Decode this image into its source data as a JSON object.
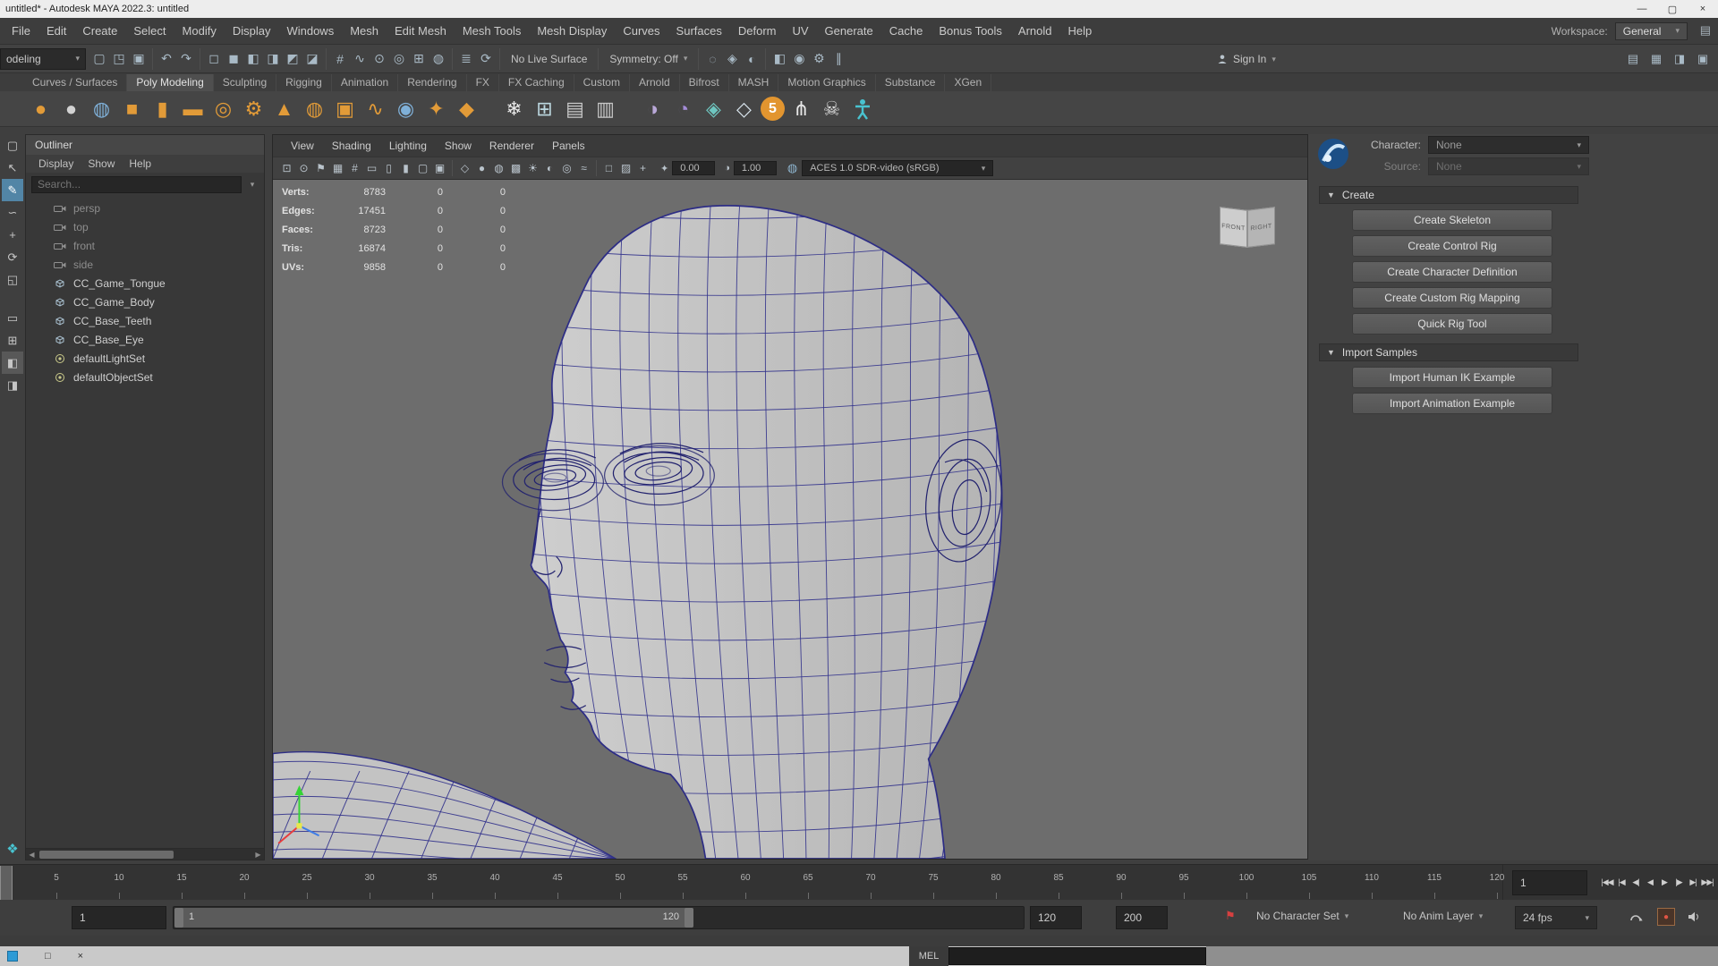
{
  "window": {
    "title": "untitled* - Autodesk MAYA 2022.3: untitled",
    "minimize_glyph": "—",
    "maximize_glyph": "▢",
    "close_glyph": "×"
  },
  "menubar": {
    "items": [
      "File",
      "Edit",
      "Create",
      "Select",
      "Modify",
      "Display",
      "Windows",
      "Mesh",
      "Edit Mesh",
      "Mesh Tools",
      "Mesh Display",
      "Curves",
      "Surfaces",
      "Deform",
      "UV",
      "Generate",
      "Cache",
      "Bonus Tools",
      "Arnold",
      "Help"
    ],
    "workspace_label": "Workspace:",
    "workspace_value": "General"
  },
  "statusline": {
    "mode": "odeling",
    "segments": [
      {
        "icons": [
          {
            "n": "new-scene-icon",
            "g": "▢"
          },
          {
            "n": "open-scene-icon",
            "g": "◳"
          },
          {
            "n": "save-scene-icon",
            "g": "▣"
          }
        ]
      },
      {
        "icons": [
          {
            "n": "undo-icon",
            "g": "↶"
          },
          {
            "n": "redo-icon",
            "g": "↷"
          }
        ]
      },
      {
        "icons": [
          {
            "n": "select-by-hierarchy-icon",
            "g": "◻"
          },
          {
            "n": "select-by-object-icon",
            "g": "◼"
          },
          {
            "n": "select-by-component-icon",
            "g": "◧"
          },
          {
            "n": "select-mask-points-icon",
            "g": "◨"
          },
          {
            "n": "select-mask-lines-icon",
            "g": "◩"
          },
          {
            "n": "select-mask-faces-icon",
            "g": "◪"
          }
        ]
      },
      {
        "icons": [
          {
            "n": "snap-to-grid-icon",
            "g": "#"
          },
          {
            "n": "snap-to-curve-icon",
            "g": "∿"
          },
          {
            "n": "snap-to-point-icon",
            "g": "⊙"
          },
          {
            "n": "snap-to-projected-center-icon",
            "g": "◎"
          },
          {
            "n": "snap-to-view-plane-icon",
            "g": "⊞"
          },
          {
            "n": "make-live-icon",
            "g": "◍"
          }
        ]
      },
      {
        "icons": [
          {
            "n": "construction-history-icon",
            "g": "≣"
          },
          {
            "n": "recent-commands-icon",
            "g": "⟳"
          }
        ]
      },
      {
        "text": "No Live Surface",
        "n": "no-live-surface-label"
      },
      {
        "text": "Symmetry: Off",
        "n": "symmetry-dropdown",
        "arrow": true
      },
      {
        "icons": [
          {
            "n": "highlight-selection-icon",
            "g": "◌"
          },
          {
            "n": "wireframe-on-shaded-toggle-icon",
            "g": "◈"
          },
          {
            "n": "default-material-icon",
            "g": "◐"
          }
        ]
      },
      {
        "icons": [
          {
            "n": "render-current-frame-icon",
            "g": "◧"
          },
          {
            "n": "ipr-render-icon",
            "g": "◉"
          },
          {
            "n": "render-settings-icon",
            "g": "⚙"
          },
          {
            "n": "pause-icon",
            "g": "∥"
          }
        ]
      }
    ],
    "sign_in": "Sign In",
    "right_toggles": [
      {
        "n": "toggle-modeling-toolkit-icon",
        "g": "▤"
      },
      {
        "n": "toggle-humanik-icon",
        "g": "▦"
      },
      {
        "n": "toggle-attribute-editor-icon",
        "g": "◨"
      },
      {
        "n": "toggle-channel-box-icon",
        "g": "▣"
      }
    ]
  },
  "shelf": {
    "tabs": [
      "Curves / Surfaces",
      "Poly Modeling",
      "Sculpting",
      "Rigging",
      "Animation",
      "Rendering",
      "FX",
      "FX Caching",
      "Custom",
      "Arnold",
      "Bifrost",
      "MASH",
      "Motion Graphics",
      "Substance",
      "XGen"
    ],
    "active_tab": "Poly Modeling",
    "icons": [
      {
        "n": "poly-sphere-icon",
        "g": "●",
        "c": "#e29b38"
      },
      {
        "n": "nurbs-sphere-icon",
        "g": "●",
        "c": "#d2d2d2"
      },
      {
        "n": "subdiv-sphere-icon",
        "g": "◍",
        "c": "#7fb0d8"
      },
      {
        "n": "poly-cube-icon",
        "g": "■",
        "c": "#e29b38"
      },
      {
        "n": "poly-cylinder-icon",
        "g": "▮",
        "c": "#e29b38"
      },
      {
        "n": "poly-plane-icon",
        "g": "▬",
        "c": "#e29b38"
      },
      {
        "n": "poly-torus-icon",
        "g": "◎",
        "c": "#e29b38"
      },
      {
        "n": "poly-gear-icon",
        "g": "⚙",
        "c": "#e29b38"
      },
      {
        "n": "poly-cone-icon",
        "g": "▲",
        "c": "#e29b38"
      },
      {
        "n": "poly-disc-icon",
        "g": "◍",
        "c": "#e29b38"
      },
      {
        "n": "poly-pipe-icon",
        "g": "▣",
        "c": "#e29b38"
      },
      {
        "n": "poly-helix-icon",
        "g": "∿",
        "c": "#e29b38"
      },
      {
        "n": "poly-soccerball-icon",
        "g": "◉",
        "c": "#7fb0d8"
      },
      {
        "n": "platonic-solid-icon",
        "g": "✦",
        "c": "#e29b38"
      },
      {
        "n": "super-shape-icon",
        "g": "◆",
        "c": "#e29b38"
      },
      {
        "sep": true
      },
      {
        "n": "sculpt-mesh-icon",
        "g": "❄",
        "c": "#e8e8e8"
      },
      {
        "n": "mash-network-icon",
        "g": "⊞",
        "c": "#bcd8e0"
      },
      {
        "n": "image-plane-icon",
        "g": "▤",
        "c": "#c8c8c8"
      },
      {
        "n": "free-image-plane-icon",
        "g": "▥",
        "c": "#c8c8c8"
      },
      {
        "sep": true
      },
      {
        "n": "sphere-projection-icon",
        "g": "◑",
        "c": "#b9a8d8"
      },
      {
        "n": "uv-sphere-icon",
        "g": "◔",
        "c": "#a48cd8"
      },
      {
        "n": "sample-spheres-icon",
        "g": "◈",
        "c": "#6ec6c0"
      },
      {
        "n": "sample-spheres-light-icon",
        "g": "◇",
        "c": "#d8e4ec"
      },
      {
        "n": "five-badge-icon",
        "g": "5",
        "badge": true
      },
      {
        "n": "joint-tool-icon",
        "g": "⋔",
        "c": "#e6e6e6"
      },
      {
        "n": "skeleton-skull-icon",
        "g": "☠",
        "c": "#dcdcdc"
      },
      {
        "n": "humanik-character-icon",
        "svg": "person"
      }
    ]
  },
  "toolbox": {
    "tools": [
      {
        "n": "select-marquee-tool-icon",
        "g": "▢"
      },
      {
        "n": "select-tool-icon",
        "g": "↖"
      },
      {
        "n": "paint-select-t ool-icon",
        "g": "✎",
        "active": true
      },
      {
        "n": "lasso-tool-icon",
        "g": "∽"
      },
      {
        "n": "move-tool-icon",
        "g": "+"
      },
      {
        "n": "rotate-tool-icon",
        "g": "⟳"
      },
      {
        "n": "scale-tool-icon",
        "g": "◱"
      },
      {
        "n": "layout-single-pane-icon",
        "g": "▭",
        "gap": true
      },
      {
        "n": "layout-four-pane-icon",
        "g": "⊞"
      },
      {
        "n": "layout-outliner-pane-icon",
        "g": "◧",
        "current": true
      },
      {
        "n": "layout-custom-pane-icon",
        "g": "◨"
      }
    ],
    "bottom_icon": {
      "n": "xgen-editor-icon",
      "g": "❖"
    }
  },
  "outliner": {
    "title": "Outliner",
    "menus": [
      "Display",
      "Show",
      "Help"
    ],
    "search_placeholder": "Search...",
    "items": [
      {
        "label": "persp",
        "icon": "camera",
        "dim": true
      },
      {
        "label": "top",
        "icon": "camera",
        "dim": true
      },
      {
        "label": "front",
        "icon": "camera",
        "dim": true
      },
      {
        "label": "side",
        "icon": "camera",
        "dim": true
      },
      {
        "label": "CC_Game_Tongue",
        "icon": "mesh"
      },
      {
        "label": "CC_Game_Body",
        "icon": "mesh"
      },
      {
        "label": "CC_Base_Teeth",
        "icon": "mesh"
      },
      {
        "label": "CC_Base_Eye",
        "icon": "mesh"
      },
      {
        "label": "defaultLightSet",
        "icon": "set"
      },
      {
        "label": "defaultObjectSet",
        "icon": "set"
      }
    ]
  },
  "viewport": {
    "menus": [
      "View",
      "Shading",
      "Lighting",
      "Show",
      "Renderer",
      "Panels"
    ],
    "toolbar_icons": [
      {
        "n": "frame-all-icon",
        "g": "⊡"
      },
      {
        "n": "frame-selection-icon",
        "g": "⊙"
      },
      {
        "n": "bookmark-icon",
        "g": "⚑"
      },
      {
        "n": "camera-attributes-icon",
        "g": "▦"
      },
      {
        "n": "grid-toggle-icon",
        "g": "#"
      },
      {
        "n": "film-gate-icon",
        "g": "▭"
      },
      {
        "n": "resolution-gate-icon",
        "g": "▯"
      },
      {
        "n": "gate-mask-icon",
        "g": "▮"
      },
      {
        "n": "safe-action-icon",
        "g": "▢"
      },
      {
        "n": "safe-title-icon",
        "g": "▣"
      },
      {
        "sep": true
      },
      {
        "n": "wireframe-display-icon",
        "g": "◇"
      },
      {
        "n": "smooth-shade-icon",
        "g": "●"
      },
      {
        "n": "wireframe-on-shaded-icon",
        "g": "◍"
      },
      {
        "n": "textured-display-icon",
        "g": "▩"
      },
      {
        "n": "use-all-lights-icon",
        "g": "☀"
      },
      {
        "n": "shadows-icon",
        "g": "◐"
      },
      {
        "n": "ambient-occlusion-icon",
        "g": "◎"
      },
      {
        "n": "motion-blur-icon",
        "g": "≈"
      },
      {
        "sep": true
      },
      {
        "n": "isolate-select-icon",
        "g": "□"
      },
      {
        "n": "xray-icon",
        "g": "▨"
      },
      {
        "n": "joint-xray-icon",
        "g": "+"
      }
    ],
    "exposure_icon": "✦",
    "exposure": "0.00",
    "gamma_icon": "◑",
    "gamma": "1.00",
    "colorspace": "ACES 1.0 SDR-video (sRGB)",
    "hud": [
      {
        "label": "Verts:",
        "v1": "8783",
        "v2": "0",
        "v3": "0"
      },
      {
        "label": "Edges:",
        "v1": "17451",
        "v2": "0",
        "v3": "0"
      },
      {
        "label": "Faces:",
        "v1": "8723",
        "v2": "0",
        "v3": "0"
      },
      {
        "label": "Tris:",
        "v1": "16874",
        "v2": "0",
        "v3": "0"
      },
      {
        "label": "UVs:",
        "v1": "9858",
        "v2": "0",
        "v3": "0"
      }
    ],
    "viewcube": {
      "front": "FRONT",
      "right": "RIGHT"
    }
  },
  "humanik": {
    "character_label": "Character:",
    "character_value": "None",
    "source_label": "Source:",
    "source_value": "None",
    "sections": [
      {
        "title": "Create",
        "buttons": [
          "Create Skeleton",
          "Create Control Rig",
          "Create Character Definition",
          "Create Custom Rig Mapping",
          "Quick Rig Tool"
        ]
      },
      {
        "title": "Import Samples",
        "buttons": [
          "Import Human IK Example",
          "Import Animation Example"
        ]
      }
    ]
  },
  "timeline": {
    "start": 1,
    "end": 120,
    "label_step": 5,
    "current_frame": "1",
    "playback": [
      {
        "n": "go-to-start-button",
        "g": "|◀◀"
      },
      {
        "n": "step-back-key-button",
        "g": "|◀"
      },
      {
        "n": "step-back-frame-button",
        "g": "◀|"
      },
      {
        "n": "play-backwards-button",
        "g": "◀"
      },
      {
        "n": "play-forwards-button",
        "g": "▶"
      },
      {
        "n": "step-forward-frame-button",
        "g": "|▶"
      },
      {
        "n": "step-forward-key-button",
        "g": "▶|"
      },
      {
        "n": "go-to-end-button",
        "g": "▶▶|"
      }
    ]
  },
  "range_slider": {
    "animation_start": "1",
    "range_start_label": "1",
    "range_end_label": "120",
    "playback_end": "120",
    "animation_end": "200",
    "character_set": "No Character Set",
    "anim_layer": "No Anim Layer",
    "fps": "24 fps"
  },
  "command_line": {
    "label": "MEL"
  },
  "background_window": {
    "maximize_glyph": "□",
    "close_glyph": "×"
  }
}
